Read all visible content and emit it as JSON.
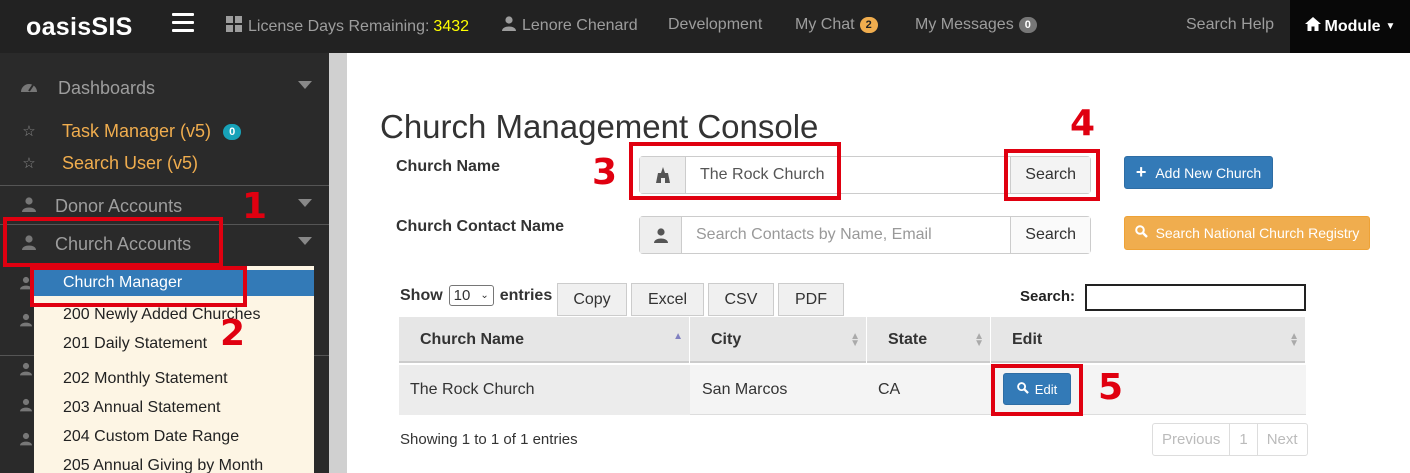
{
  "topbar": {
    "brand": "oasisSIS",
    "license_label": "License Days Remaining:",
    "license_days": "3432",
    "user_name": "Lenore Chenard",
    "development": "Development",
    "my_chat": "My Chat",
    "my_chat_count": "2",
    "my_messages": "My Messages",
    "my_messages_count": "0",
    "search_help": "Search Help",
    "module": "Module"
  },
  "sidebar": {
    "dashboards": "Dashboards",
    "task_manager": "Task Manager (v5)",
    "task_manager_count": "0",
    "search_user": "Search User (v5)",
    "donor_accounts": "Donor Accounts",
    "church_accounts": "Church Accounts",
    "submenu": {
      "active": "Church Manager",
      "items": [
        "200 Newly Added Churches",
        "201 Daily Statement",
        "202 Monthly Statement",
        "203 Annual Statement",
        "204 Custom Date Range",
        "205 Annual Giving by Month"
      ]
    }
  },
  "main": {
    "title": "Church Management Console",
    "church_name_label": "Church Name",
    "church_name_value": "The Rock Church",
    "church_search_button": "Search",
    "add_new_church": "Add New Church",
    "contact_label": "Church Contact Name",
    "contact_placeholder": "Search Contacts by Name, Email",
    "contact_search_button": "Search",
    "national_registry": "Search National Church Registry"
  },
  "datatable": {
    "show_label": "Show",
    "entries_label": "entries",
    "page_size": "10",
    "buttons": [
      "Copy",
      "Excel",
      "CSV",
      "PDF"
    ],
    "search_label": "Search:",
    "columns": [
      "Church Name",
      "City",
      "State",
      "Edit"
    ],
    "rows": [
      {
        "church_name": "The Rock Church",
        "city": "San Marcos",
        "state": "CA",
        "edit": "Edit"
      }
    ],
    "info": "Showing 1 to 1 of 1 entries",
    "pager": {
      "previous": "Previous",
      "page": "1",
      "next": "Next"
    }
  },
  "annotations": [
    "1",
    "2",
    "3",
    "4",
    "5"
  ],
  "colors": {
    "topbar_bg": "#222222",
    "sidebar_bg": "#2a2a2a",
    "primary_blue": "#337ab7",
    "warning_orange": "#f0ad4e",
    "annotation_red": "#e00010"
  }
}
